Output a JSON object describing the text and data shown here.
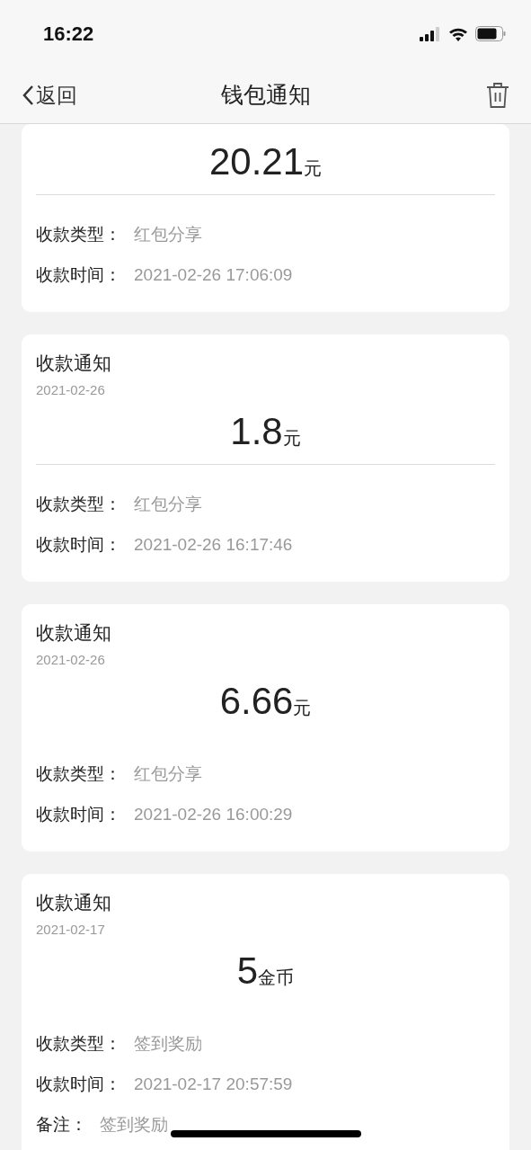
{
  "status_bar": {
    "time": "16:22"
  },
  "nav": {
    "back": "返回",
    "title": "钱包通知"
  },
  "cards": [
    {
      "amount": "20.21",
      "unit": "元",
      "divider": true,
      "rows": [
        {
          "label": "收款类型：",
          "value": "红包分享"
        },
        {
          "label": "收款时间：",
          "value": "2021-02-26 17:06:09"
        }
      ]
    },
    {
      "title": "收款通知",
      "date": "2021-02-26",
      "amount": "1.8",
      "unit": "元",
      "divider": true,
      "rows": [
        {
          "label": "收款类型：",
          "value": "红包分享"
        },
        {
          "label": "收款时间：",
          "value": "2021-02-26 16:17:46"
        }
      ]
    },
    {
      "title": "收款通知",
      "date": "2021-02-26",
      "amount": "6.66",
      "unit": "元",
      "divider": false,
      "rows": [
        {
          "label": "收款类型：",
          "value": "红包分享"
        },
        {
          "label": "收款时间：",
          "value": "2021-02-26 16:00:29"
        }
      ]
    },
    {
      "title": "收款通知",
      "date": "2021-02-17",
      "amount": "5",
      "unit": "金币",
      "divider": false,
      "rows": [
        {
          "label": "收款类型：",
          "value": "签到奖励"
        },
        {
          "label": "收款时间：",
          "value": "2021-02-17 20:57:59"
        },
        {
          "label": "备注：",
          "value": "签到奖励"
        }
      ]
    }
  ]
}
